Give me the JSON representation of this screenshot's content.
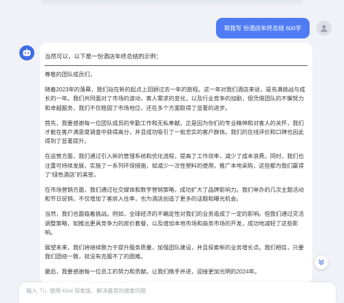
{
  "user_message": "帮我写 份酒店年终总结 600字",
  "bot": {
    "intro": "当然可以，以下是一份酒店年终总结的示例：",
    "paragraphs": [
      "尊敬的团队成员们，",
      "随着2023年的落幕，我们站在新的起点上回顾过去一年的旅程。这一年对我们酒店来说，是充满挑战与成长的一年。我们共同面对了市场的波动，客人需求的变化，以及行业竞争的加剧，但凭借团队的不懈努力和卓越服务，我们不仅稳固了市场地位，还在多个方面取得了显著的进步。",
      "首先，我要感谢每一位团队成员的辛勤工作和无私奉献。正是因为你们的专业精神和对客人的关怀，我们才能在客户满意度调查中获得高分，并且成功吸引了一批忠实的客户群体。我们的在线评价和口碑也因此得到了显著提升。",
      "在运营方面，我们通过引入新的管理系统和优化流程，提高了工作效率，减少了成本浪费。同时，我们也注重可持续发展，实施了一系列环保措施，如减少一次性塑料的使用，推广本地采购，这些都为我们赢得了“绿色酒店”的美誉。",
      "在市场营销方面，我们通过社交媒体和数字营销策略，成功扩大了品牌影响力。我们举办的几次主题活动和节日促销，不仅增加了客房入住率，也为酒店创造了更多的话题和曝光机会。",
      "当然，我们也面临着挑战。例如，全球经济的不确定性对我们的业务造成了一定的影响。但我们通过灵活调整策略，如推出更具竞争力的房价套餐，以及增加本地市场和商务市场的开发，成功地减轻了这些影响。",
      "展望未来，我们将继续致力于提升服务质量，加强团队建设，并且探索新的业务增长点。我们相信，只要我们团结一致，就没有克服不了的困难。",
      "最后，我要感谢每一位员工的努力和贡献。让我们携手并进，迎接更加光明的2024年。"
    ]
  },
  "input": {
    "placeholder": "输入「/」使用 Kimi 探索版、解决最常的搜索问题"
  },
  "colors": {
    "accent": "#4f7cf5",
    "bot_avatar": "#3f6ce6",
    "background": "#f0f2f7"
  },
  "icons": {
    "user_avatar": "person-icon",
    "bot_avatar": "robot-icon",
    "scroll_down": "double-chevron-down-icon"
  }
}
